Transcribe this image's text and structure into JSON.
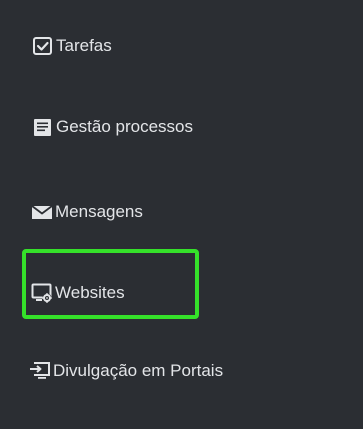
{
  "sidebar": {
    "items": [
      {
        "label": "Tarefas",
        "icon": "checkbox-icon"
      },
      {
        "label": "Gestão processos",
        "icon": "document-icon"
      },
      {
        "label": "Mensagens",
        "icon": "envelope-icon"
      },
      {
        "label": "Websites",
        "icon": "monitor-gear-icon"
      },
      {
        "label": "Divulgação em Portais",
        "icon": "monitor-import-icon"
      }
    ],
    "highlighted_item": "Websites"
  },
  "colors": {
    "background": "#2b2e33",
    "text": "#e3e5e8",
    "highlight": "#35e12a"
  }
}
